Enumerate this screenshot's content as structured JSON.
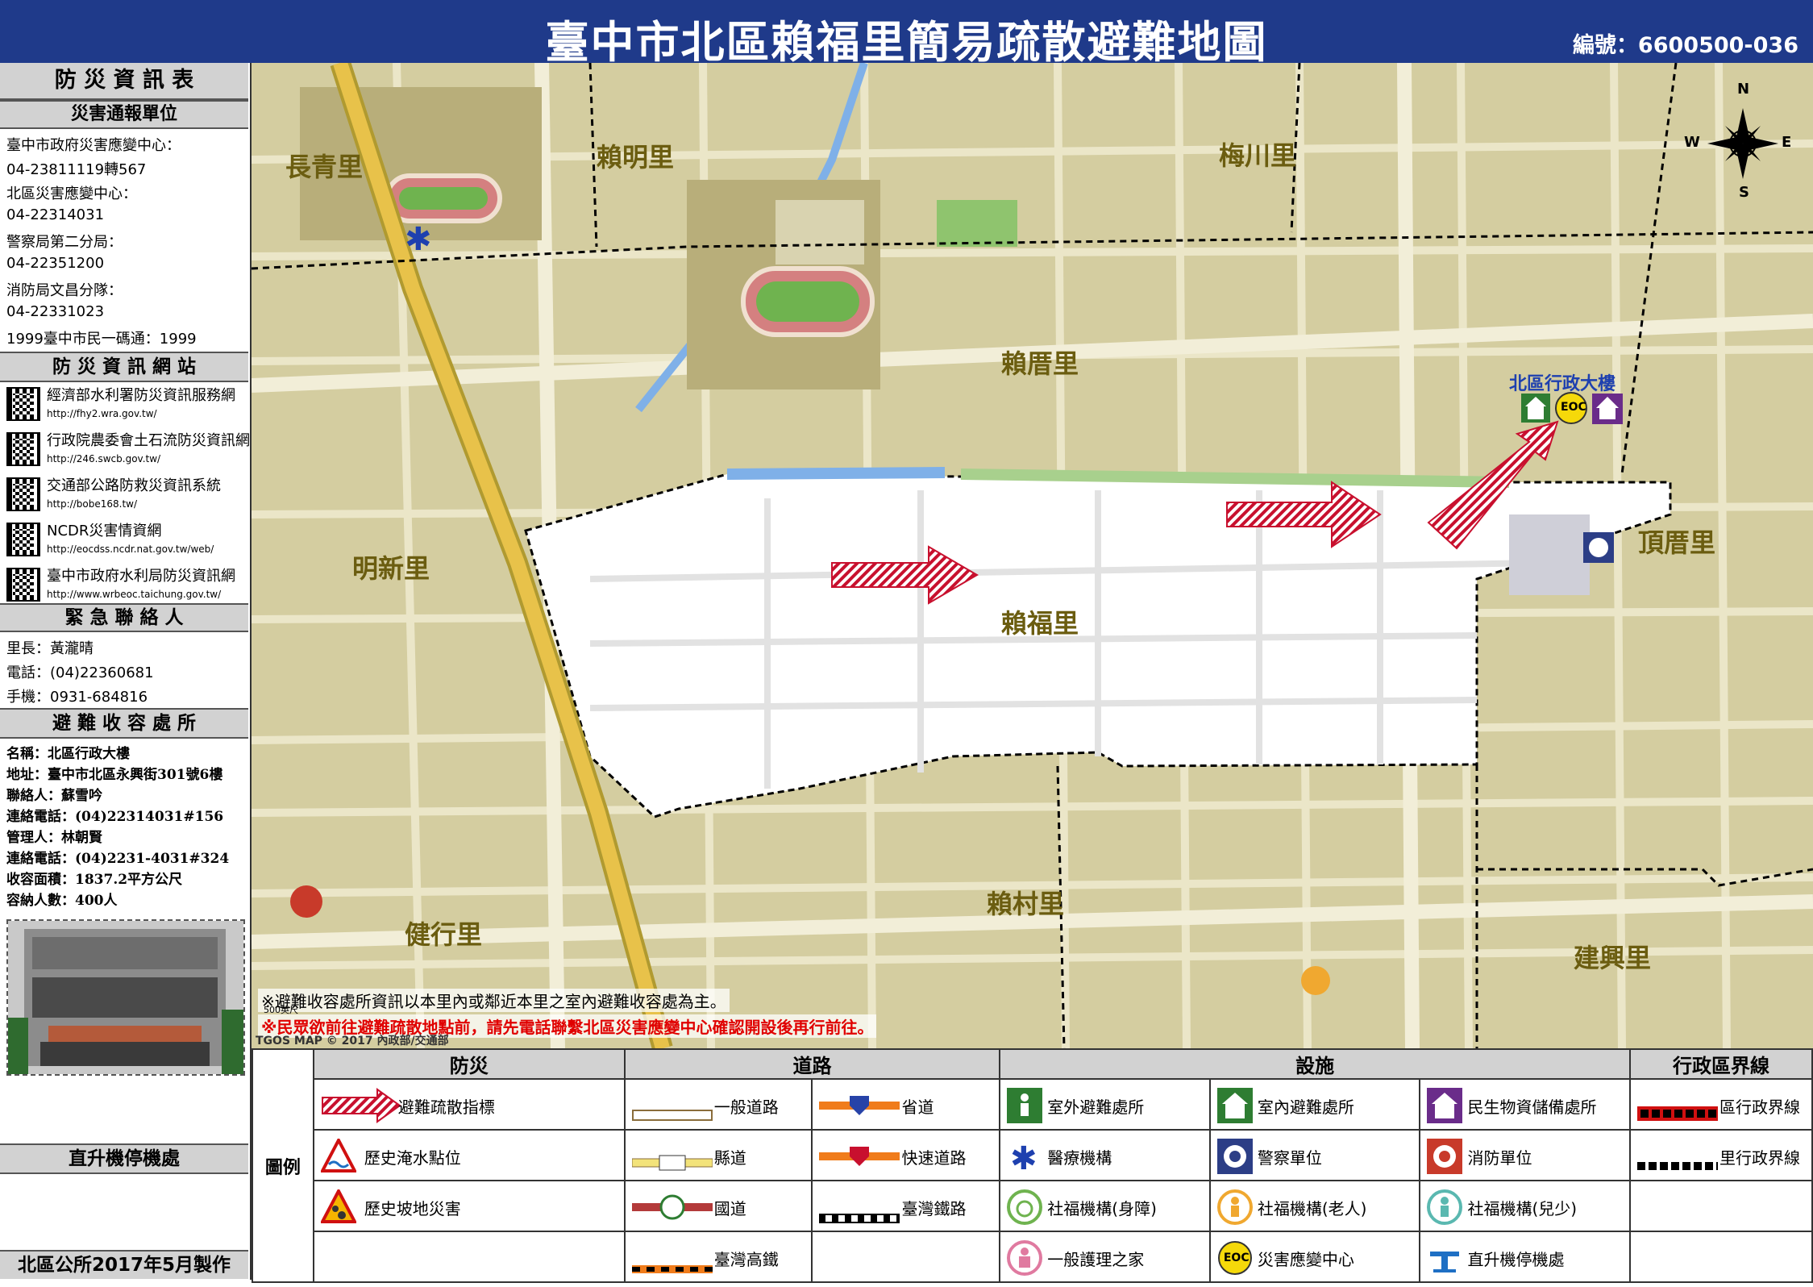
{
  "header": {
    "title": "臺中市北區賴福里簡易疏散避難地圖",
    "code": "編號：6600500-036"
  },
  "left_panel": {
    "info_title": "防 災 資 訊 表",
    "report_title": "災害通報單位",
    "report_lines": [
      "臺中市政府災害應變中心：",
      "04-23811119轉567",
      "北區災害應變中心：",
      "04-22314031",
      "警察局第二分局：",
      "04-22351200",
      "消防局文昌分隊：",
      "04-22331023",
      "1999臺中市民一碼通：1999"
    ],
    "web_title": "防 災 資 訊 網 站",
    "websites": [
      {
        "name": "經濟部水利署防災資訊服務網",
        "url": "http://fhy2.wra.gov.tw/"
      },
      {
        "name": "行政院農委會土石流防災資訊網",
        "url": "http://246.swcb.gov.tw/"
      },
      {
        "name": "交通部公路防救災資訊系統",
        "url": "http://bobe168.tw/"
      },
      {
        "name": "NCDR災害情資網",
        "url": "http://eocdss.ncdr.nat.gov.tw/web/"
      },
      {
        "name": "臺中市政府水利局防災資訊網",
        "url": "http://www.wrbeoc.taichung.gov.tw/"
      }
    ],
    "contact_title": "緊 急 聯 絡 人",
    "contact_lines": [
      "里長：黃瀧晴",
      "電話：(04)22360681",
      "手機：0931-684816"
    ],
    "shelter_title": "避 難 收 容 處 所",
    "shelter_lines": [
      "名稱：北區行政大樓",
      "地址：臺中市北區永興街301號6樓",
      "聯絡人：蘇雪吟",
      "連絡電話：(04)22314031#156",
      "管理人：林朝賢",
      "連絡電話：(04)2231-4031#324",
      "收容面積：1837.2平方公尺",
      "容納人數：400人"
    ],
    "helipad_title": "直升機停機處",
    "footer": "北區公所2017年5月製作"
  },
  "map": {
    "districts": [
      {
        "name": "長青里"
      },
      {
        "name": "賴明里"
      },
      {
        "name": "梅川里"
      },
      {
        "name": "賴厝里"
      },
      {
        "name": "明新里"
      },
      {
        "name": "賴福里"
      },
      {
        "name": "頂厝里"
      },
      {
        "name": "健行里"
      },
      {
        "name": "賴村里"
      },
      {
        "name": "建興里"
      }
    ],
    "facility_label": "北區行政大樓",
    "compass": {
      "n": "N",
      "s": "S",
      "e": "E",
      "w": "W"
    },
    "eoc_text": "EOC",
    "notice1": "※避難收容處所資訊以本里內或鄰近本里之室內避難收容處為主。",
    "notice2": "※民眾欲前往避難疏散地點前，請先電話聯繫北區災害應變中心確認開設後再行前往。",
    "scale": "500英尺",
    "copyright": "TGOS MAP © 2017 內政部/交通部",
    "colors": {
      "background": "#d4cda0",
      "highlight_area": "#ffffff",
      "arrow": "#c8102e",
      "river": "#7fb0e8",
      "park": "#a8d08d",
      "highway": "#e8c24a"
    }
  },
  "legend": {
    "side_label": "圖例",
    "headers": {
      "disaster": "防災",
      "road": "道路",
      "facility": "設施",
      "boundary": "行政區界線"
    },
    "disaster": [
      "避難疏散指標",
      "歷史淹水點位",
      "歷史坡地災害"
    ],
    "road": [
      "一般道路",
      "省道",
      "縣道",
      "快速道路",
      "國道",
      "臺灣鐵路",
      "臺灣高鐵"
    ],
    "facility": [
      "室外避難處所",
      "室內避難處所",
      "民生物資儲備處所",
      "醫療機構",
      "警察單位",
      "消防單位",
      "社福機構(身障)",
      "社福機構(老人)",
      "社福機構(兒少)",
      "一般護理之家",
      "災害應變中心",
      "直升機停機處"
    ],
    "boundary": [
      "區行政界線",
      "里行政界線"
    ]
  }
}
